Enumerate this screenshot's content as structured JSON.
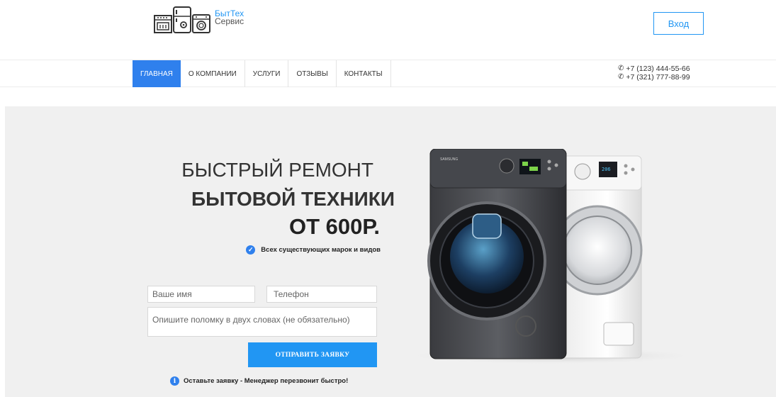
{
  "header": {
    "logo_line1": "БытТех",
    "logo_line2": "Сервис",
    "login_label": "Вход"
  },
  "nav": {
    "items": [
      {
        "label": "ГЛАВНАЯ",
        "active": true
      },
      {
        "label": "О КОМПАНИИ",
        "active": false
      },
      {
        "label": "УСЛУГИ",
        "active": false
      },
      {
        "label": "ОТЗЫВЫ",
        "active": false
      },
      {
        "label": "КОНТАКТЫ",
        "active": false
      }
    ],
    "phones": [
      "+7 (123) 444-55-66",
      "+7 (321) 777-88-99"
    ]
  },
  "hero": {
    "line1": "БЫСТРЫЙ РЕМОНТ",
    "line2": "БЫТОВОЙ ТЕХНИКИ",
    "line3": "ОТ 600Р.",
    "feature": "Всех существующих марок и видов"
  },
  "form": {
    "name_placeholder": "Ваше имя",
    "phone_placeholder": "Телефон",
    "desc_placeholder": "Опишите поломку в двух словах (не обязательно)",
    "submit_label": "ОТПРАВИТЬ ЗАЯВКУ",
    "note": "Оставьте заявку - Менеджер перезвонит быстро!"
  },
  "colors": {
    "accent": "#2f80ed",
    "button": "#2196f3",
    "hero_bg": "#f0f0f0"
  }
}
